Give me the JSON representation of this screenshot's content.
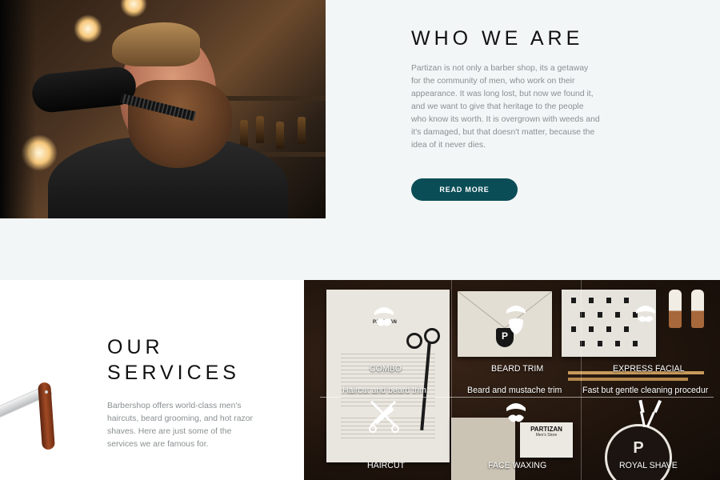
{
  "about": {
    "title": "WHO WE ARE",
    "text": "Partizan is not only a barber shop, its a getaway for the community of men, who work on their appearance. It was long lost, but now we found it, and we want to give that heritage to the people who know its worth. It is overgrown with weeds and it's damaged, but that doesn't matter, because the idea of it never dies.",
    "button_label": "READ MORE",
    "button_color": "#0b4d56"
  },
  "services": {
    "title_line1": "OUR",
    "title_line2": "SERVICES",
    "text": "Barbershop offers world-class men's haircuts, beard grooming, and hot razor shaves. Here are just some of the services we are famous for.",
    "items": [
      {
        "name": "COMBO",
        "description": "Haircut and beard trim",
        "icon": "mustache-icon"
      },
      {
        "name": "BEARD TRIM",
        "description": "Beard and mustache trim",
        "icon": "beard-icon"
      },
      {
        "name": "EXPRESS FACIAL",
        "description": "Fast but gentle cleaning procedur",
        "icon": "face-icon"
      },
      {
        "name": "HAIRCUT",
        "icon": "scissors-comb-icon"
      },
      {
        "name": "FACE WAXING",
        "icon": "mustache-icon"
      },
      {
        "name": "ROYAL SHAVE",
        "icon": "razors-icon"
      }
    ]
  },
  "props": {
    "letterhead_brand": "PARTIZAN",
    "card_brand": "PARTIZAN",
    "card_subtitle": "Men's Store",
    "logo_letter": "P"
  }
}
